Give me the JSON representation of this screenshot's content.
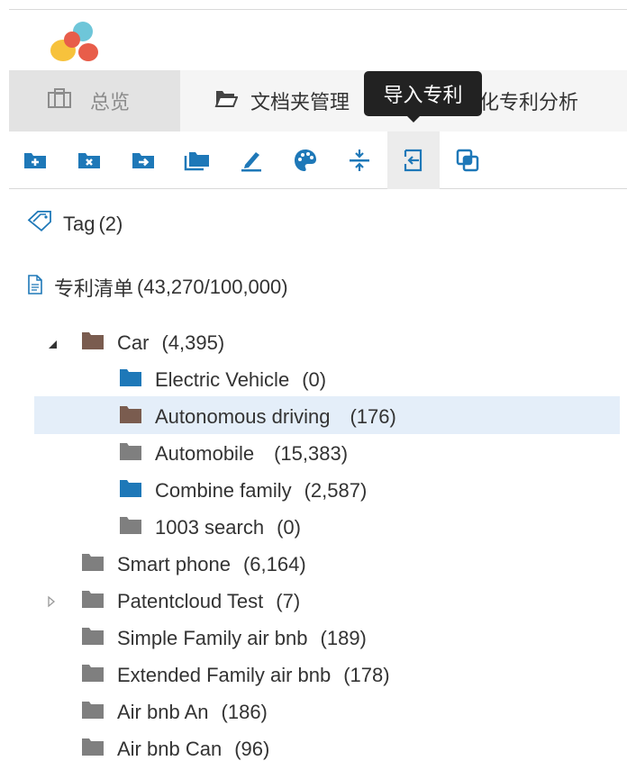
{
  "tabs": {
    "overview": "总览",
    "folders": "文档夹管理",
    "industry": "产业化专利分析"
  },
  "tooltip": "导入专利",
  "toolbar": [
    {
      "name": "new-folder-icon"
    },
    {
      "name": "delete-folder-icon"
    },
    {
      "name": "move-folder-icon"
    },
    {
      "name": "copy-folder-icon"
    },
    {
      "name": "rename-icon"
    },
    {
      "name": "palette-icon"
    },
    {
      "name": "expand-collapse-icon"
    },
    {
      "name": "import-icon"
    },
    {
      "name": "merge-icon"
    }
  ],
  "colors": {
    "accent_blue": "#1e78b8",
    "folder_brown": "#7a5c4f",
    "folder_gray": "#7f7f7f",
    "highlight": "#e4eef9",
    "tooltip_bg": "#222222"
  },
  "tag": {
    "label": "Tag",
    "count": "(2)"
  },
  "patent_list": {
    "label": "专利清单",
    "count": "(43,270/100,000)"
  },
  "tree": [
    {
      "label": "Car",
      "count": "(4,395)",
      "color": "brown",
      "expanded": true,
      "children": [
        {
          "label": "Electric Vehicle",
          "count": "(0)",
          "color": "blue"
        },
        {
          "label": "Autonomous driving",
          "count": "(176)",
          "color": "brown",
          "selected": true
        },
        {
          "label": "Automobile",
          "count": "(15,383)",
          "color": "gray"
        },
        {
          "label": "Combine family",
          "count": "(2,587)",
          "color": "blue"
        },
        {
          "label": "1003 search",
          "count": "(0)",
          "color": "gray"
        }
      ]
    },
    {
      "label": "Smart phone",
      "count": "(6,164)",
      "color": "gray"
    },
    {
      "label": "Patentcloud Test",
      "count": "(7)",
      "color": "gray",
      "collapsed": true
    },
    {
      "label": "Simple Family air bnb",
      "count": "(189)",
      "color": "gray"
    },
    {
      "label": "Extended Family air bnb",
      "count": "(178)",
      "color": "gray"
    },
    {
      "label": "Air bnb An",
      "count": "(186)",
      "color": "gray"
    },
    {
      "label": "Air bnb Can",
      "count": "(96)",
      "color": "gray"
    }
  ]
}
